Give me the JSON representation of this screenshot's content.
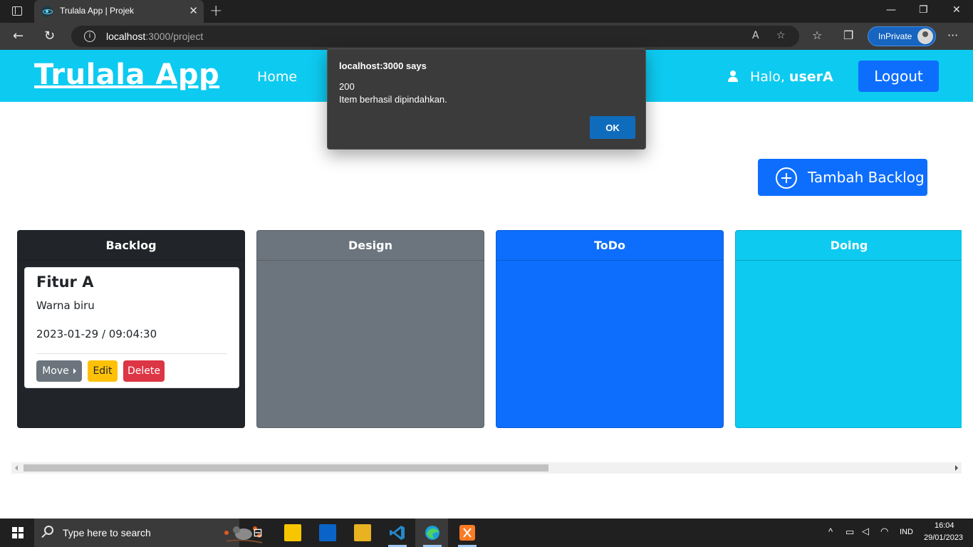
{
  "browser": {
    "tab_title": "Trulala App | Projek",
    "tab_close": "✕",
    "new_tab": "+",
    "url_host": "localhost",
    "url_rest": ":3000/project",
    "inprivate_label": "InPrivate",
    "window_minimize": "—",
    "window_restore": "❐",
    "window_close": "✕"
  },
  "app": {
    "brand": "Trulala App",
    "nav_home": "Home",
    "greeting_prefix": "Halo, ",
    "username": "userA",
    "logout_label": "Logout",
    "add_backlog_label": "Tambah Backlog",
    "accent_color": "#0dcaf0",
    "primary_color": "#0d6efd"
  },
  "board": {
    "columns": [
      {
        "title": "Backlog",
        "color": "#212529"
      },
      {
        "title": "Design",
        "color": "#6c757d"
      },
      {
        "title": "ToDo",
        "color": "#0d6efd"
      },
      {
        "title": "Doing",
        "color": "#0dcaf0"
      }
    ],
    "cards": [
      {
        "column": "Backlog",
        "title": "Fitur A",
        "description": "Warna biru",
        "datetime": "2023-01-29 / 09:04:30",
        "move_label": "Move",
        "edit_label": "Edit",
        "delete_label": "Delete"
      }
    ]
  },
  "dialog": {
    "title": "localhost:3000 says",
    "line1": "200",
    "line2": "Item berhasil dipindahkan.",
    "ok_label": "OK"
  },
  "taskbar": {
    "search_placeholder": "Type here to search",
    "language": "IND",
    "time": "16:04",
    "date": "29/01/2023"
  }
}
